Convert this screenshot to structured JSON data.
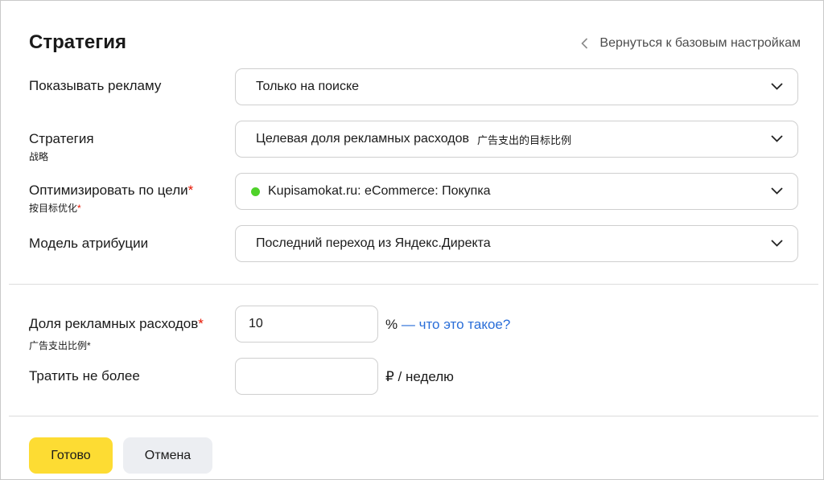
{
  "header": {
    "title": "Стратегия",
    "back_link": "Вернуться к базовым настройкам"
  },
  "rows": [
    {
      "label": "Показывать рекламу",
      "value": "Только на поиске"
    },
    {
      "label": "Стратегия",
      "sublabel": "战略",
      "value": "Целевая доля рекламных расходов",
      "value_note": "广告支出的目标比例"
    },
    {
      "label": "Оптимизировать по цели",
      "sublabel": "按目标优化",
      "required": "*",
      "value": "Kupisamokat.ru: eCommerce: Покупка",
      "status_color": "#4fd22a"
    },
    {
      "label": "Модель атрибуции",
      "value": "Последний переход из Яндекс.Директа"
    }
  ],
  "budget": {
    "share_label": "Доля рекламных расходов",
    "share_sublabel": "广告支出比例*",
    "required": "*",
    "share_value": "10",
    "share_unit": "%",
    "share_link": "— что это такое?",
    "limit_label": "Тратить не более",
    "limit_value": "",
    "limit_unit": "₽ / неделю"
  },
  "actions": {
    "done": "Готово",
    "cancel": "Отмена"
  },
  "colors": {
    "accent_button": "#fddc33",
    "secondary_button": "#eceef2",
    "link": "#2a6ed8",
    "required": "#e61400"
  }
}
